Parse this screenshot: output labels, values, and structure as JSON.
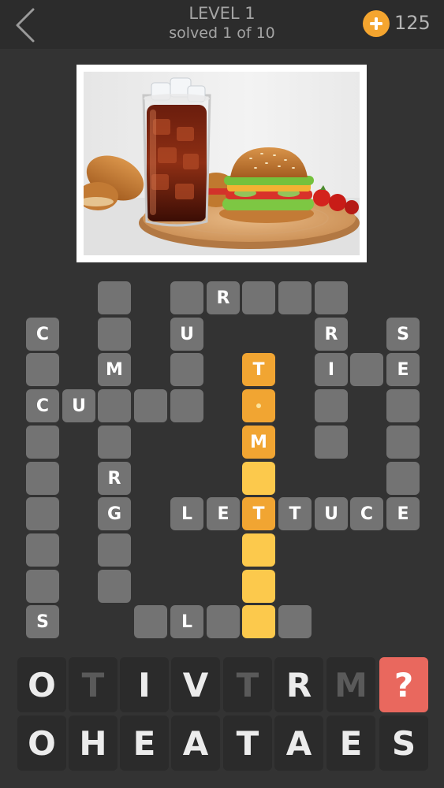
{
  "header": {
    "level_title": "LEVEL 1",
    "progress": "solved 1 of 10",
    "coins": "125"
  },
  "clue_image": {
    "description_icon": "burger-and-cola-photo"
  },
  "colors": {
    "background": "#333333",
    "cell": "#737373",
    "selected_cell": "#f1a532",
    "highlighted_word": "#fcc94c",
    "coin": "#f4a52f",
    "hint_key": "#e9685e"
  },
  "grid": {
    "cells": [
      {
        "r": 0,
        "c": 2,
        "t": ""
      },
      {
        "r": 0,
        "c": 4,
        "t": ""
      },
      {
        "r": 0,
        "c": 5,
        "t": "R"
      },
      {
        "r": 0,
        "c": 6,
        "t": ""
      },
      {
        "r": 0,
        "c": 7,
        "t": ""
      },
      {
        "r": 0,
        "c": 8,
        "t": ""
      },
      {
        "r": 1,
        "c": 0,
        "t": "C"
      },
      {
        "r": 1,
        "c": 2,
        "t": ""
      },
      {
        "r": 1,
        "c": 4,
        "t": "U"
      },
      {
        "r": 1,
        "c": 8,
        "t": "R"
      },
      {
        "r": 1,
        "c": 10,
        "t": "S"
      },
      {
        "r": 2,
        "c": 0,
        "t": ""
      },
      {
        "r": 2,
        "c": 2,
        "t": "M"
      },
      {
        "r": 2,
        "c": 4,
        "t": ""
      },
      {
        "r": 2,
        "c": 6,
        "t": "T",
        "s": "sel"
      },
      {
        "r": 2,
        "c": 8,
        "t": "I"
      },
      {
        "r": 2,
        "c": 9,
        "t": ""
      },
      {
        "r": 2,
        "c": 10,
        "t": "E"
      },
      {
        "r": 3,
        "c": 0,
        "t": "C"
      },
      {
        "r": 3,
        "c": 1,
        "t": "U"
      },
      {
        "r": 3,
        "c": 2,
        "t": ""
      },
      {
        "r": 3,
        "c": 3,
        "t": ""
      },
      {
        "r": 3,
        "c": 4,
        "t": ""
      },
      {
        "r": 3,
        "c": 6,
        "t": "",
        "s": "sel",
        "dot": true
      },
      {
        "r": 3,
        "c": 8,
        "t": ""
      },
      {
        "r": 3,
        "c": 10,
        "t": ""
      },
      {
        "r": 4,
        "c": 0,
        "t": ""
      },
      {
        "r": 4,
        "c": 2,
        "t": ""
      },
      {
        "r": 4,
        "c": 6,
        "t": "M",
        "s": "sel"
      },
      {
        "r": 4,
        "c": 8,
        "t": ""
      },
      {
        "r": 4,
        "c": 10,
        "t": ""
      },
      {
        "r": 5,
        "c": 0,
        "t": ""
      },
      {
        "r": 5,
        "c": 2,
        "t": "R"
      },
      {
        "r": 5,
        "c": 6,
        "t": "",
        "s": "hl"
      },
      {
        "r": 5,
        "c": 10,
        "t": ""
      },
      {
        "r": 6,
        "c": 0,
        "t": ""
      },
      {
        "r": 6,
        "c": 2,
        "t": "G"
      },
      {
        "r": 6,
        "c": 4,
        "t": "L"
      },
      {
        "r": 6,
        "c": 5,
        "t": "E"
      },
      {
        "r": 6,
        "c": 6,
        "t": "T",
        "s": "sel"
      },
      {
        "r": 6,
        "c": 7,
        "t": "T"
      },
      {
        "r": 6,
        "c": 8,
        "t": "U"
      },
      {
        "r": 6,
        "c": 9,
        "t": "C"
      },
      {
        "r": 6,
        "c": 10,
        "t": "E"
      },
      {
        "r": 7,
        "c": 0,
        "t": ""
      },
      {
        "r": 7,
        "c": 2,
        "t": ""
      },
      {
        "r": 7,
        "c": 6,
        "t": "",
        "s": "hl"
      },
      {
        "r": 8,
        "c": 0,
        "t": ""
      },
      {
        "r": 8,
        "c": 2,
        "t": ""
      },
      {
        "r": 8,
        "c": 6,
        "t": "",
        "s": "hl"
      },
      {
        "r": 9,
        "c": 0,
        "t": "S"
      },
      {
        "r": 9,
        "c": 3,
        "t": ""
      },
      {
        "r": 9,
        "c": 4,
        "t": "L"
      },
      {
        "r": 9,
        "c": 5,
        "t": ""
      },
      {
        "r": 9,
        "c": 6,
        "t": "",
        "s": "hl"
      },
      {
        "r": 9,
        "c": 7,
        "t": ""
      }
    ]
  },
  "keyboard": {
    "row1": [
      {
        "letter": "O",
        "used": false
      },
      {
        "letter": "T",
        "used": true
      },
      {
        "letter": "I",
        "used": false
      },
      {
        "letter": "V",
        "used": false
      },
      {
        "letter": "T",
        "used": true
      },
      {
        "letter": "R",
        "used": false
      },
      {
        "letter": "M",
        "used": true
      }
    ],
    "hint_label": "?",
    "row2": [
      {
        "letter": "O",
        "used": false
      },
      {
        "letter": "H",
        "used": false
      },
      {
        "letter": "E",
        "used": false
      },
      {
        "letter": "A",
        "used": false
      },
      {
        "letter": "T",
        "used": false
      },
      {
        "letter": "A",
        "used": false
      },
      {
        "letter": "E",
        "used": false
      },
      {
        "letter": "S",
        "used": false
      }
    ]
  }
}
